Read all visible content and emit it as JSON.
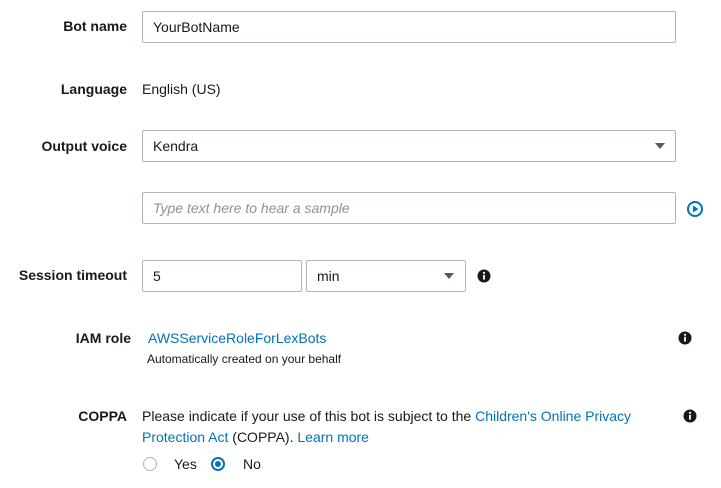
{
  "bot_name": {
    "label": "Bot name",
    "value": "YourBotName"
  },
  "language": {
    "label": "Language",
    "value": "English (US)"
  },
  "output_voice": {
    "label": "Output voice",
    "selected": "Kendra",
    "sample_placeholder": "Type text here to hear a sample"
  },
  "session_timeout": {
    "label": "Session timeout",
    "value": "5",
    "unit": "min"
  },
  "iam_role": {
    "label": "IAM role",
    "role_link": "AWSServiceRoleForLexBots",
    "note": "Automatically created on your behalf"
  },
  "coppa": {
    "label": "COPPA",
    "text_1": "Please indicate if your use of this bot is subject to the",
    "link_1": "Children's Online Privacy",
    "link_2": "Protection Act",
    "text_2": "(COPPA).",
    "learn_more": "Learn more",
    "options": [
      "Yes",
      "No"
    ],
    "selected": "No"
  },
  "colors": {
    "link": "#0073bb",
    "border": "#aab7b8",
    "text": "#16191f",
    "placeholder": "#879596"
  }
}
